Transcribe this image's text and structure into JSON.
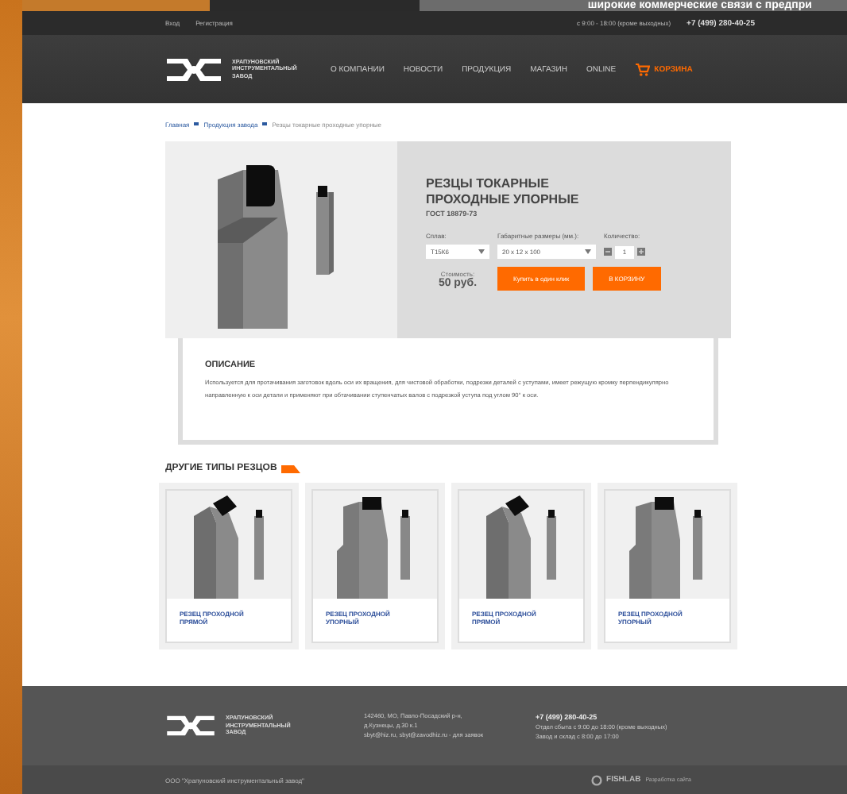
{
  "banner": {
    "text": "широкие коммерческие связи с предпри"
  },
  "top_bar": {
    "links": [
      "Вход",
      "Регистрация"
    ],
    "hours": "с 9:00 - 18:00 (кроме выходных)",
    "phone": "+7 (499) 280-40-25"
  },
  "header": {
    "logo_text": "ХРАПУНОВСКИЙ ИНСТРУМЕНТАЛЬНЫЙ ЗАВОД",
    "nav": [
      {
        "label": "О КОМПАНИИ",
        "kind": "link"
      },
      {
        "label": "НОВОСТИ",
        "kind": "link"
      },
      {
        "label": "ПРОДУКЦИЯ",
        "kind": "link"
      },
      {
        "label": "МАГАЗИН",
        "kind": "link"
      },
      {
        "label": "ONLINE",
        "kind": "link"
      },
      {
        "label": "КОРЗИНА",
        "kind": "cart"
      }
    ]
  },
  "breadcrumbs": [
    {
      "label": "Главная",
      "link": true
    },
    {
      "label": "Продукция завода",
      "link": true
    },
    {
      "label": "Резцы токарные проходные упорные",
      "link": false
    }
  ],
  "product": {
    "kind": "upright",
    "title": "РЕЗЦЫ ТОКАРНЫЕ ПРОХОДНЫЕ УПОРНЫЕ",
    "standard": "ГОСТ 18879-73",
    "fields": [
      {
        "label": "Сплав:",
        "kind": "select",
        "value": "Т15К6"
      },
      {
        "label": "Габаритные размеры (мм.):",
        "kind": "select",
        "value": "20 х 12 х 100"
      },
      {
        "label": "Количество:",
        "kind": "quantity",
        "value": "1"
      }
    ],
    "price_label": "Стоимость:",
    "price": "50 руб.",
    "buttons": [
      "Купить в один клик",
      "В КОРЗИНУ"
    ],
    "description_title": "ОПИСАНИЕ",
    "description": "Используется для протачивания заготовок вдоль оси их вращения, для чистовой обработки, подрезки деталей с уступами, имеет режущую кромку перпендикулярно направленную к оси детали и применяют при обтачивании ступенчатых валов с подрезкой уступа под углом 90° к оси."
  },
  "other_types": {
    "title": "ДРУГИЕ ТИПЫ РЕЗЦОВ",
    "items": [
      {
        "title": "РЕЗЕЦ ПРОХОДНОЙ ПРЯМОЙ",
        "kind": "angled"
      },
      {
        "title": "РЕЗЕЦ ПРОХОДНОЙ УПОРНЫЙ",
        "kind": "upright"
      },
      {
        "title": "РЕЗЕЦ ПРОХОДНОЙ ПРЯМОЙ",
        "kind": "angled"
      },
      {
        "title": "РЕЗЕЦ ПРОХОДНОЙ УПОРНЫЙ",
        "kind": "upright"
      }
    ]
  },
  "footer": {
    "logo_text": "ХРАПУНОВСКИЙ ИНСТРУМЕНТАЛЬНЫЙ ЗАВОД",
    "address": [
      "142460, МО, Павло-Посадский р-н,",
      "д.Кузнецы, д.30 к.1",
      "sbyt@hiz.ru, sbyt@zavodhiz.ru - для заявок"
    ],
    "phone": "+7 (499) 280-40-25",
    "hours": [
      "Отдел сбыта с 9:00 до 18:00 (кроме выходных)",
      "Завод и склад с 8:00 до 17:00"
    ],
    "copyright": "ООО \"Храпуновский инструментальный завод\"",
    "developer": "FISHLAB",
    "developer_note": "Разработка сайта"
  }
}
